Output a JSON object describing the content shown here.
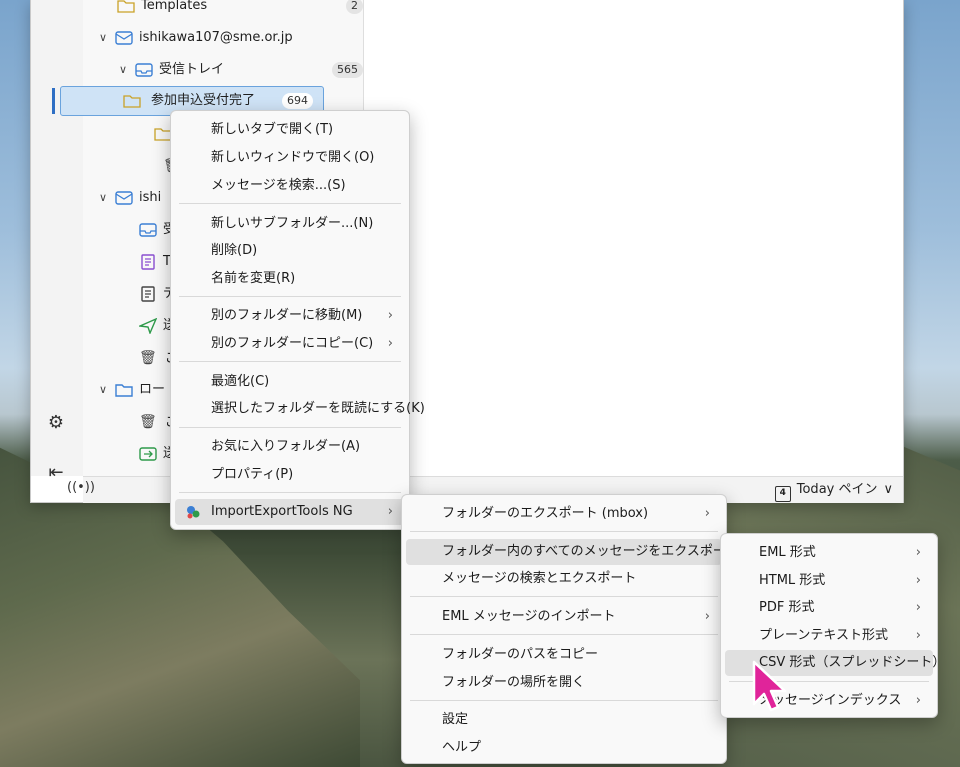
{
  "folder_tree": {
    "templates": {
      "label": "Templates",
      "count": "2"
    },
    "account1": {
      "label": "ishikawa107@sme.or.jp"
    },
    "inbox": {
      "label": "受信トレイ",
      "count": "565"
    },
    "selected_folder": {
      "label": "参加申込受付完了",
      "count": "694"
    },
    "trash1_fragment": "こ",
    "account2_fragment": "ishi",
    "inbox2_fragment": "受",
    "templates2_fragment": "T",
    "drafts2_fragment": "デ",
    "sent2_fragment": "送",
    "trash2_fragment": "こ",
    "local_fragment": "ロー",
    "local_trash_fragment": "こ",
    "local_outbox_fragment": "送"
  },
  "statusbar": {
    "today_label": "Today ペイン",
    "calendar_day": "4"
  },
  "context_menu": {
    "items": [
      {
        "label": "新しいタブで開く(T)"
      },
      {
        "label": "新しいウィンドウで開く(O)"
      },
      {
        "label": "メッセージを検索...(S)"
      },
      {
        "label": "新しいサブフォルダー...(N)"
      },
      {
        "label": "削除(D)"
      },
      {
        "label": "名前を変更(R)"
      },
      {
        "label": "別のフォルダーに移動(M)"
      },
      {
        "label": "別のフォルダーにコピー(C)"
      },
      {
        "label": "最適化(C)"
      },
      {
        "label": "選択したフォルダーを既読にする(K)"
      },
      {
        "label": "お気に入りフォルダー(A)"
      },
      {
        "label": "プロパティ(P)"
      },
      {
        "label": "ImportExportTools NG"
      }
    ]
  },
  "submenu_ietng": {
    "items": [
      {
        "label": "フォルダーのエクスポート (mbox)"
      },
      {
        "label": "フォルダー内のすべてのメッセージをエクスポート"
      },
      {
        "label": "メッセージの検索とエクスポート"
      },
      {
        "label": "EML メッセージのインポート"
      },
      {
        "label": "フォルダーのパスをコピー"
      },
      {
        "label": "フォルダーの場所を開く"
      },
      {
        "label": "設定"
      },
      {
        "label": "ヘルプ"
      }
    ]
  },
  "submenu_export_all": {
    "items": [
      {
        "label": "EML 形式"
      },
      {
        "label": "HTML 形式"
      },
      {
        "label": "PDF 形式"
      },
      {
        "label": "プレーンテキスト形式"
      },
      {
        "label": "CSV 形式（スプレッドシート）"
      },
      {
        "label": "メッセージインデックス"
      }
    ]
  },
  "icons": {
    "settings": "gear-icon",
    "collapse": "collapse-pane-icon",
    "submenu_arrow": "chevron-right-icon"
  },
  "colors": {
    "accent": "#2f6fc4",
    "selection": "#cfe3f6",
    "cursor": "#e0249a"
  }
}
